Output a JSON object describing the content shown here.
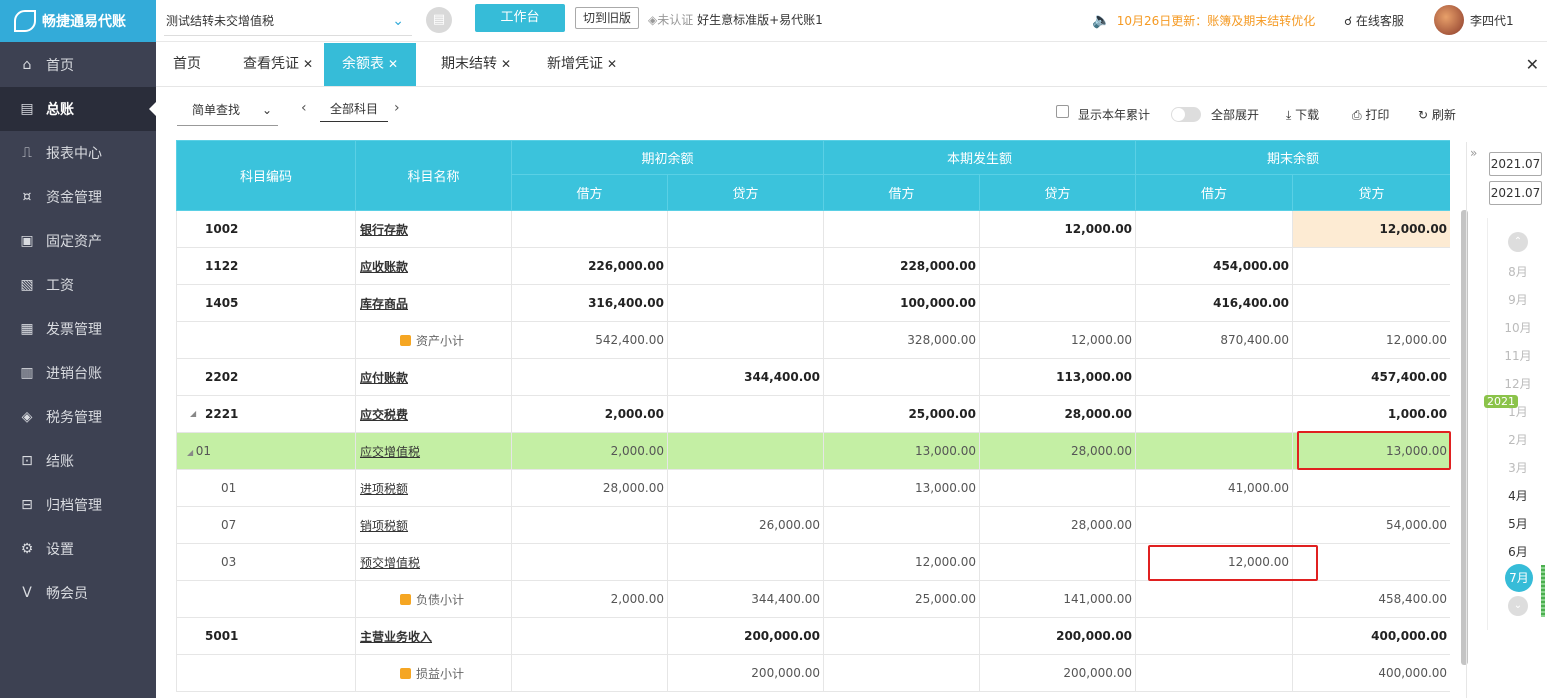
{
  "app": {
    "logo": "畅捷通易代账"
  },
  "sidebar": {
    "items": [
      {
        "label": "首页",
        "icon": "home-icon"
      },
      {
        "label": "总账",
        "icon": "ledger-icon",
        "active": true
      },
      {
        "label": "报表中心",
        "icon": "chart-icon"
      },
      {
        "label": "资金管理",
        "icon": "money-bag-icon"
      },
      {
        "label": "固定资产",
        "icon": "asset-icon"
      },
      {
        "label": "工资",
        "icon": "salary-icon"
      },
      {
        "label": "发票管理",
        "icon": "invoice-icon"
      },
      {
        "label": "进销台账",
        "icon": "inventory-icon"
      },
      {
        "label": "税务管理",
        "icon": "tax-icon"
      },
      {
        "label": "结账",
        "icon": "close-period-icon"
      },
      {
        "label": "归档管理",
        "icon": "archive-icon"
      },
      {
        "label": "设置",
        "icon": "gear-icon"
      },
      {
        "label": "畅会员",
        "icon": "vip-icon"
      }
    ]
  },
  "topbar": {
    "company": "测试结转未交增值税",
    "work_label": "工作台",
    "old_label": "切到旧版",
    "cert_status": "未认证",
    "plan": "好生意标准版+易代账1",
    "notice": "10月26日更新：账簿及期末结转优化",
    "support": "在线客服",
    "user": "李四代1"
  },
  "tabs": [
    {
      "label": "首页",
      "closable": false
    },
    {
      "label": "查看凭证",
      "closable": true
    },
    {
      "label": "余额表",
      "closable": true,
      "active": true
    },
    {
      "label": "期末结转",
      "closable": true
    },
    {
      "label": "新增凭证",
      "closable": true
    }
  ],
  "toolbar": {
    "search_label": "简单查找",
    "subject_label": "全部科目",
    "show_year": "显示本年累计",
    "expand_all": "全部展开",
    "download": "下载",
    "print": "打印",
    "refresh": "刷新"
  },
  "table": {
    "headers": {
      "code": "科目编码",
      "name": "科目名称",
      "opening": "期初余额",
      "period": "本期发生额",
      "closing": "期末余额",
      "debit": "借方",
      "credit": "贷方"
    },
    "rows": [
      {
        "code": "1002",
        "name": "银行存款",
        "type": "bold",
        "v": [
          "",
          "",
          "",
          "12,000.00",
          "",
          "12,000.00"
        ]
      },
      {
        "code": "1122",
        "name": "应收账款",
        "type": "bold",
        "v": [
          "226,000.00",
          "",
          "228,000.00",
          "",
          "454,000.00",
          ""
        ]
      },
      {
        "code": "1405",
        "name": "库存商品",
        "type": "bold",
        "v": [
          "316,400.00",
          "",
          "100,000.00",
          "",
          "416,400.00",
          ""
        ]
      },
      {
        "code": "",
        "name": "资产小计",
        "type": "sub",
        "v": [
          "542,400.00",
          "",
          "328,000.00",
          "12,000.00",
          "870,400.00",
          "12,000.00"
        ]
      },
      {
        "code": "2202",
        "name": "应付账款",
        "type": "bold",
        "v": [
          "",
          "344,400.00",
          "",
          "113,000.00",
          "",
          "457,400.00"
        ]
      },
      {
        "code": "2221",
        "name": "应交税费",
        "type": "bold",
        "v": [
          "2,000.00",
          "",
          "25,000.00",
          "28,000.00",
          "",
          "1,000.00"
        ]
      },
      {
        "code": "01",
        "name": "应交增值税",
        "type": "sel",
        "v": [
          "2,000.00",
          "",
          "13,000.00",
          "28,000.00",
          "",
          "13,000.00"
        ]
      },
      {
        "code": "01",
        "name": "进项税额",
        "type": "normal",
        "v": [
          "28,000.00",
          "",
          "13,000.00",
          "",
          "41,000.00",
          ""
        ]
      },
      {
        "code": "07",
        "name": "销项税额",
        "type": "normal",
        "v": [
          "",
          "26,000.00",
          "",
          "28,000.00",
          "",
          "54,000.00"
        ]
      },
      {
        "code": "03",
        "name": "预交增值税",
        "type": "normal",
        "v": [
          "",
          "",
          "12,000.00",
          "",
          "12,000.00",
          ""
        ]
      },
      {
        "code": "",
        "name": "负债小计",
        "type": "sub",
        "v": [
          "2,000.00",
          "344,400.00",
          "25,000.00",
          "141,000.00",
          "",
          "458,400.00"
        ]
      },
      {
        "code": "5001",
        "name": "主营业务收入",
        "type": "bold",
        "v": [
          "",
          "200,000.00",
          "",
          "200,000.00",
          "",
          "400,000.00"
        ]
      },
      {
        "code": "",
        "name": "损益小计",
        "type": "sub",
        "v": [
          "",
          "200,000.00",
          "",
          "200,000.00",
          "",
          "400,000.00"
        ]
      }
    ]
  },
  "period": {
    "start": "2021.07",
    "end": "2021.07",
    "year_badge": "2021",
    "months": [
      "8月",
      "9月",
      "10月",
      "11月",
      "12月",
      "1月",
      "2月",
      "3月",
      "4月",
      "5月",
      "6月"
    ],
    "current": "7月"
  }
}
